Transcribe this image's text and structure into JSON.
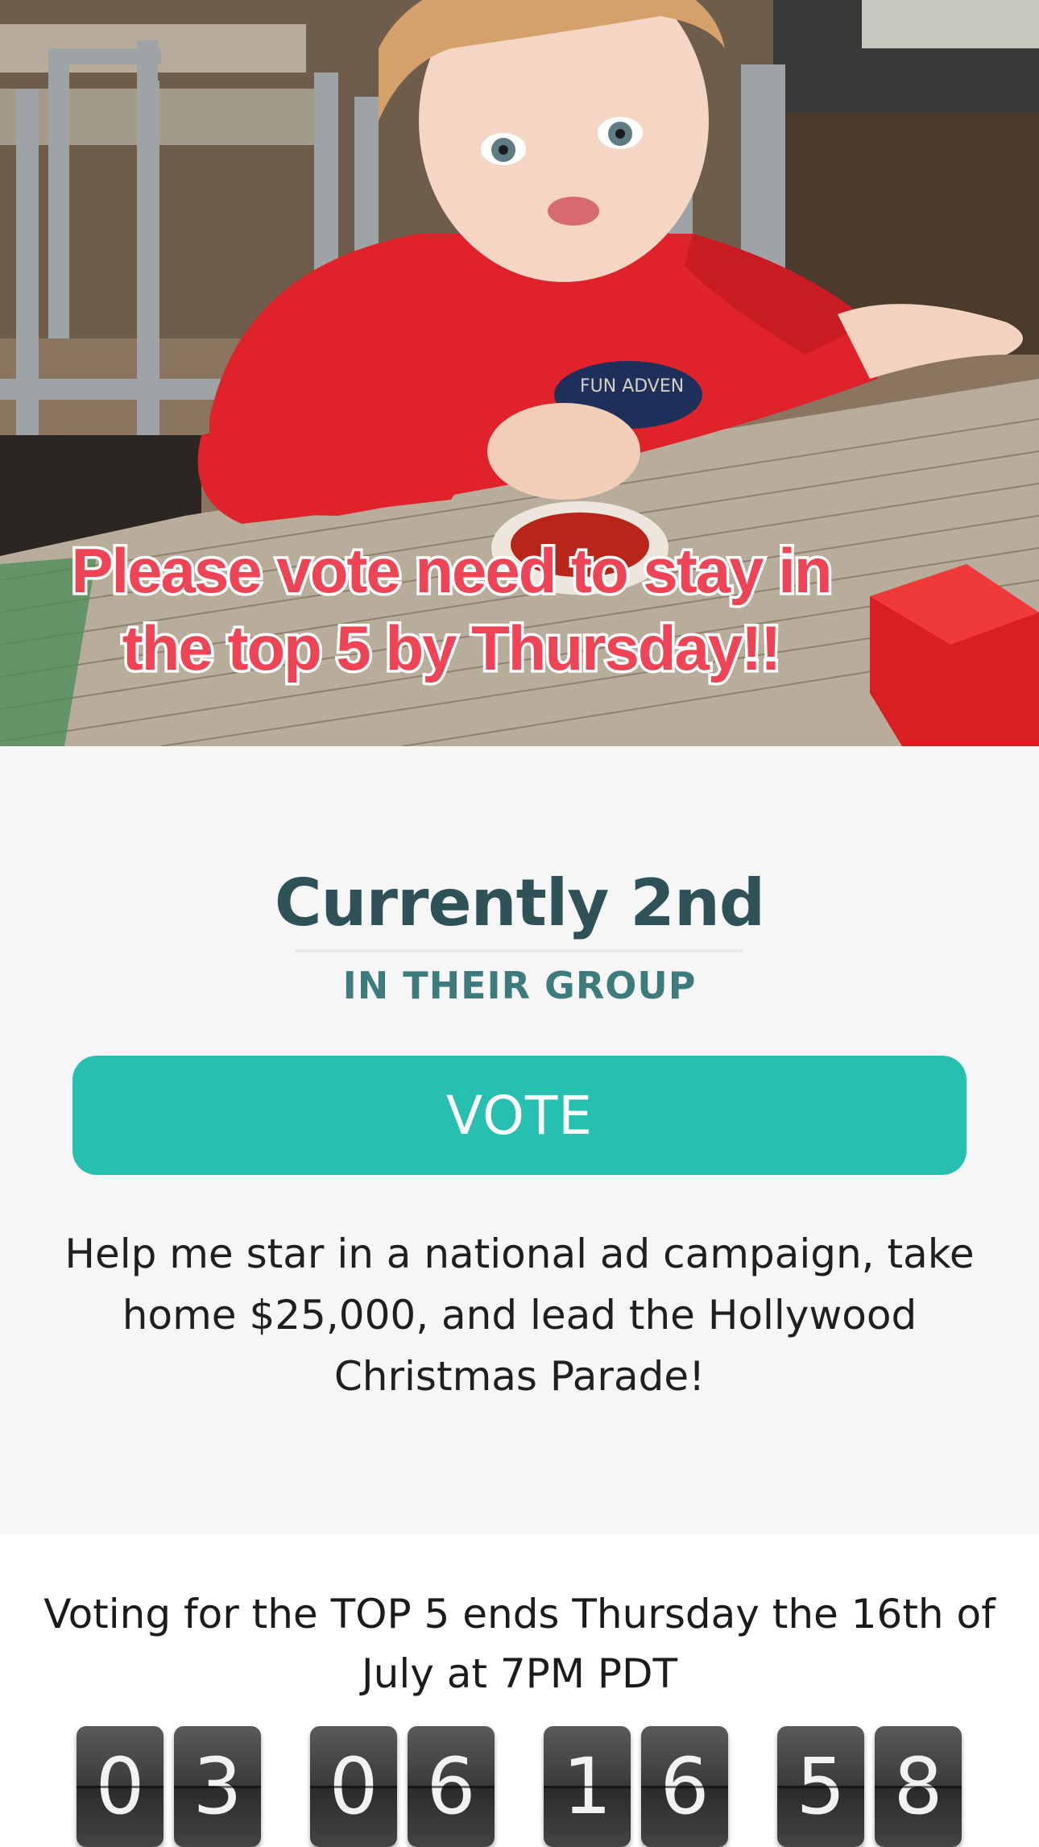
{
  "hero": {
    "caption_line1": "Please vote need to stay in",
    "caption_line2": "the top 5 by Thursday!!",
    "shirt_text": "FUN ADVEN"
  },
  "status": {
    "rank": "Currently 2nd",
    "rank_sub": "IN THEIR GROUP",
    "vote_label": "VOTE",
    "pitch": "Help me star in a national ad campaign, take home $25,000, and lead the Hollywood Christmas Parade!"
  },
  "countdown": {
    "deadline": "Voting for the TOP 5 ends Thursday the 16th of July at 7PM PDT",
    "digits": [
      "0",
      "3",
      "0",
      "6",
      "1",
      "6",
      "5",
      "8"
    ]
  },
  "colors": {
    "accent": "#27bfb0",
    "title": "#2e5257",
    "subtitle": "#3d7b7d",
    "caption": "#ef4356"
  }
}
